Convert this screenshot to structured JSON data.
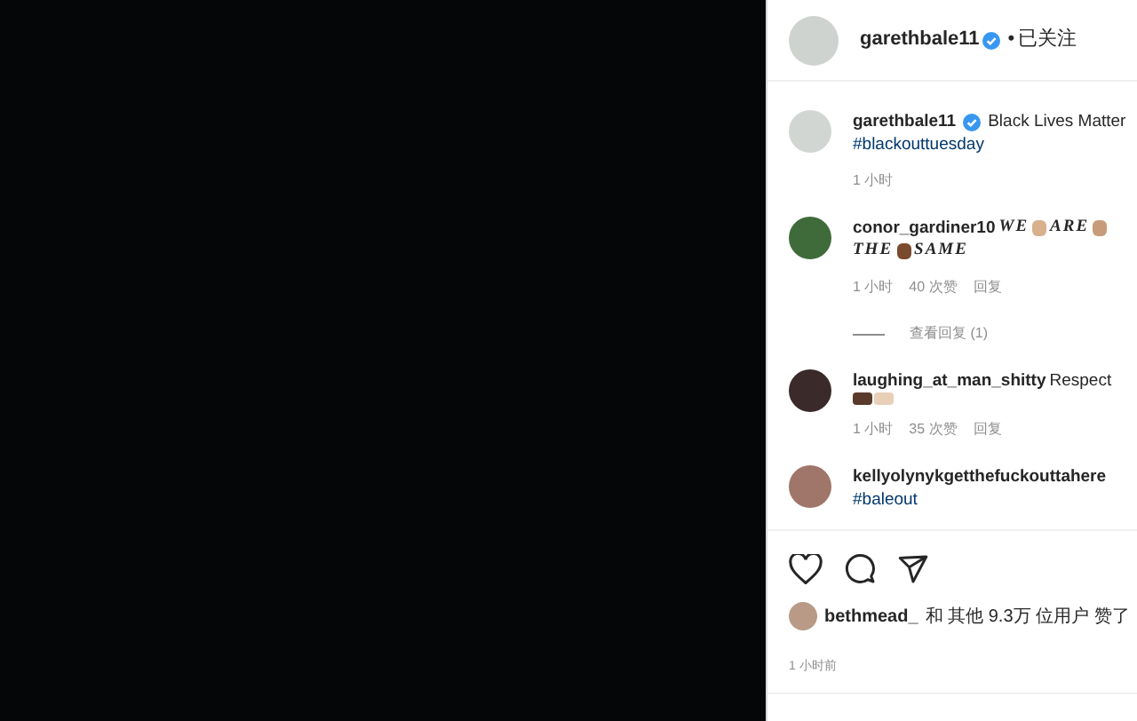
{
  "header": {
    "username": "garethbale11",
    "verified": true,
    "separator": "•",
    "follow_status": "已关注"
  },
  "comments": [
    {
      "username": "garethbale11",
      "verified": true,
      "parts": [
        {
          "kind": "text",
          "text": "Black Lives Matter"
        },
        {
          "kind": "hashtag",
          "text": "#blackouttuesday"
        }
      ],
      "time": "1 小时"
    },
    {
      "username": "conor_gardiner10",
      "verified": false,
      "parts": [
        {
          "kind": "styled",
          "text": "WE"
        },
        {
          "kind": "fist",
          "color": "#d9b08c"
        },
        {
          "kind": "styled",
          "text": "ARE"
        },
        {
          "kind": "fist",
          "color": "#c69c7a"
        },
        {
          "kind": "styled",
          "text": "THE"
        },
        {
          "kind": "fist",
          "color": "#7a4a2e"
        },
        {
          "kind": "styled",
          "text": "SAME"
        }
      ],
      "time": "1 小时",
      "likes": "40 次赞",
      "reply": "回复",
      "view_replies": "查看回复 (1)"
    },
    {
      "username": "laughing_at_man_shitty",
      "verified": false,
      "parts": [
        {
          "kind": "text",
          "text": "Respect"
        },
        {
          "kind": "hands",
          "color": "#5a3a2a"
        }
      ],
      "time": "1 小时",
      "likes": "35 次赞",
      "reply": "回复"
    },
    {
      "username": "kellyolynykgetthefuckouttahere",
      "verified": false,
      "parts": [
        {
          "kind": "hashtag",
          "text": "#baleout"
        }
      ]
    }
  ],
  "likes_line": {
    "username": "bethmead_",
    "rest": "和 其他 9.3万 位用户 赞了"
  },
  "timestamp": "1 小时前"
}
